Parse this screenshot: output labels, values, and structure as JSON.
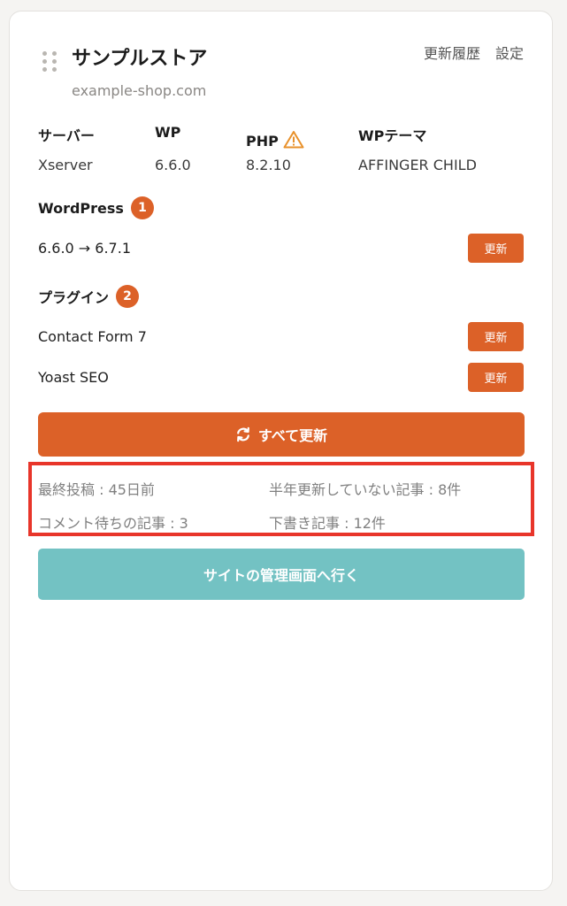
{
  "site": {
    "name": "サンプルストア",
    "url": "example-shop.com"
  },
  "header": {
    "history_link": "更新履歴",
    "settings_link": "設定"
  },
  "info": {
    "server_label": "サーバー",
    "server_value": "Xserver",
    "wp_label": "WP",
    "wp_value": "6.6.0",
    "php_label": "PHP",
    "php_value": "8.2.10",
    "theme_label": "WPテーマ",
    "theme_value": "AFFINGER CHILD"
  },
  "wordpress": {
    "title": "WordPress",
    "count": "1",
    "update_text": "6.6.0 → 6.7.1",
    "update_label": "更新"
  },
  "plugins": {
    "title": "プラグイン",
    "count": "2",
    "items": [
      {
        "name": "Contact Form 7",
        "update_label": "更新"
      },
      {
        "name": "Yoast SEO",
        "update_label": "更新"
      }
    ]
  },
  "update_all_label": "すべて更新",
  "stats": {
    "last_post": "最終投稿 : 45日前",
    "stale_posts": "半年更新していない記事 : 8件",
    "pending_comments": "コメント待ちの記事 : 3",
    "drafts": "下書き記事 : 12件"
  },
  "admin_button_label": "サイトの管理画面へ行く",
  "colors": {
    "accent": "#dc6128",
    "admin": "#73c2c3",
    "highlight": "#e8352a",
    "warning": "#e8912b"
  },
  "icons": {
    "drag": "drag-handle-icon",
    "warning": "warning-icon",
    "refresh": "refresh-icon"
  }
}
